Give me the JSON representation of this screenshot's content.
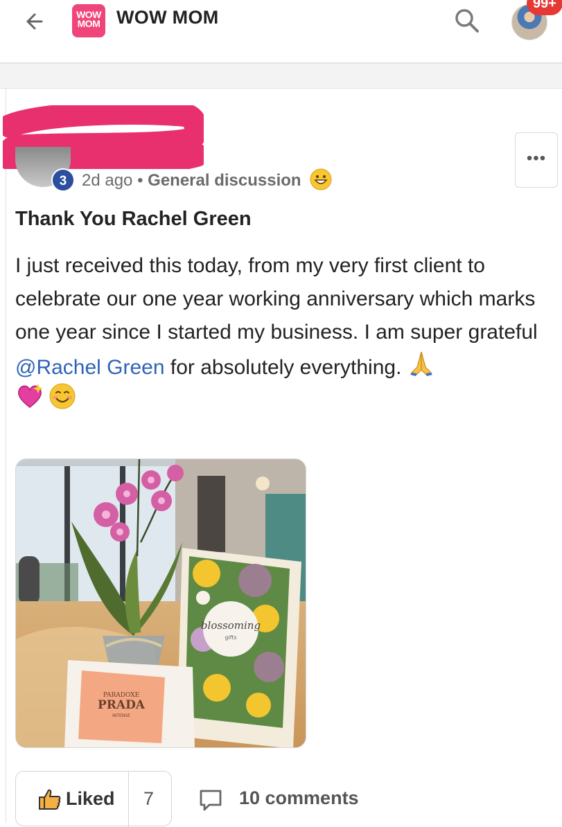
{
  "header": {
    "logo_text_line1": "WOW",
    "logo_text_line2": "MOM",
    "title": "WOW MOM",
    "notification_badge": "99+"
  },
  "post": {
    "author_rank": "3",
    "time_ago": "2d ago",
    "separator": "•",
    "category": "General discussion",
    "more_label": "•••",
    "title": "Thank You Rachel Green",
    "body_before_mention": "I just received this today, from my very first client to celebrate our one year working anniversary which marks one year since I started my business. I am super grateful ",
    "mention": "@Rachel Green",
    "body_after_mention": " for absolutely everything. ",
    "photo_text": {
      "card_logo": "blossoming",
      "card_logo_sub": "gifts",
      "box_brand_small": "PARADOXE",
      "box_brand": "PRADA",
      "box_sub": "INTENSE"
    }
  },
  "actions": {
    "like_label": "Liked",
    "like_count": "7",
    "comments_label": "10 comments"
  },
  "colors": {
    "brand_pink": "#f0457a",
    "badge_red": "#e53935",
    "rank_blue": "#2b4f9e",
    "mention_blue": "#2f63b8",
    "redaction_pink": "#e8306f"
  }
}
